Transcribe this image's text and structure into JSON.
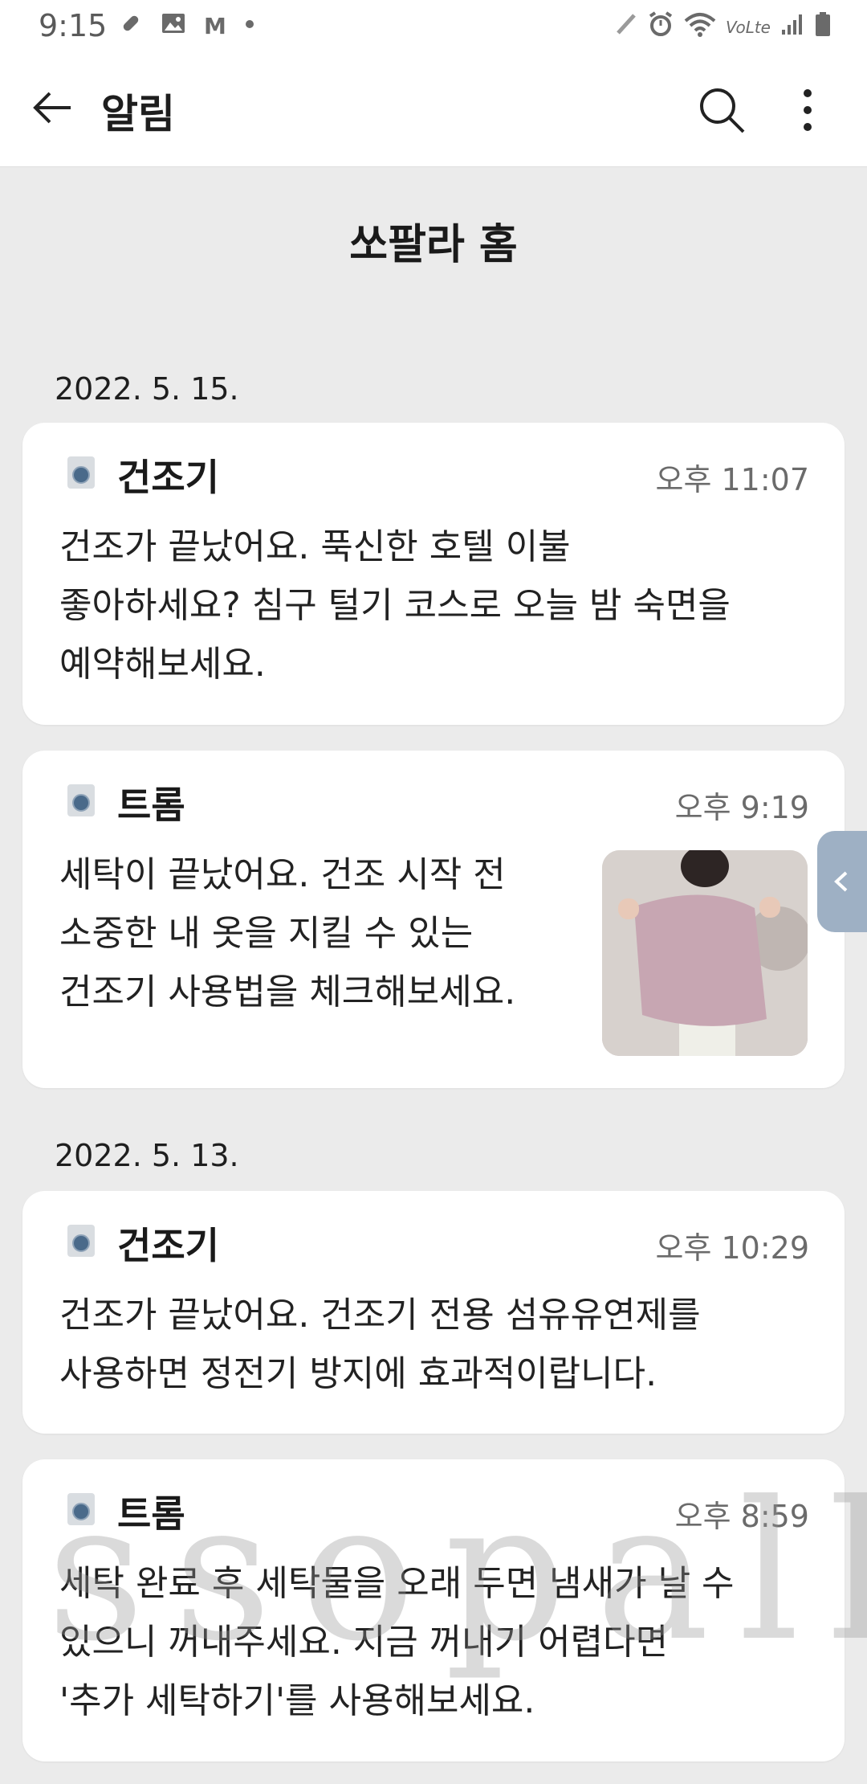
{
  "status_bar": {
    "time": "9:15",
    "left_icons": [
      "pill-icon",
      "image-icon",
      "gmail-icon",
      "dot-icon"
    ],
    "right_icons": [
      "pen-icon",
      "alarm-icon",
      "wifi-icon",
      "volte-icon",
      "signal-icon",
      "battery-icon"
    ],
    "gmail_glyph": "M",
    "volte_text": "VoLte"
  },
  "app_bar": {
    "title": "알림",
    "back_icon": "arrow-left-icon",
    "search_icon": "search-icon",
    "more_icon": "more-vertical-icon"
  },
  "section_title": "쏘팔라 홈",
  "groups": [
    {
      "date": "2022. 5. 15.",
      "items": [
        {
          "title": "건조기",
          "time": "오후 11:07",
          "body": "건조가 끝났어요. 푹신한 호텔 이불\n좋아하세요? 침구 털기 코스로 오늘 밤 숙면을\n예약해보세요."
        },
        {
          "title": "트롬",
          "time": "오후 9:19",
          "body": "세탁이 끝났어요. 건조 시작 전\n소중한 내 옷을 지킬 수 있는\n건조기 사용법을 체크해보세요.",
          "has_image": true
        }
      ]
    },
    {
      "date": "2022. 5. 13.",
      "items": [
        {
          "title": "건조기",
          "time": "오후 10:29",
          "body": "건조가 끝났어요. 건조기 전용 섬유유연제를\n사용하면 정전기 방지에 효과적이랍니다."
        },
        {
          "title": "트롬",
          "time": "오후 8:59",
          "body": "세탁 완료 후 세탁물을 오래 두면 냄새가 날 수\n있으니 꺼내주세요. 지금 꺼내기 어렵다면\n'추가 세탁하기'를 사용해보세요."
        }
      ]
    }
  ],
  "watermark": "ssopalla",
  "colors": {
    "background": "#ebebeb",
    "card": "#ffffff",
    "side_tab": "#9eb0c4"
  }
}
